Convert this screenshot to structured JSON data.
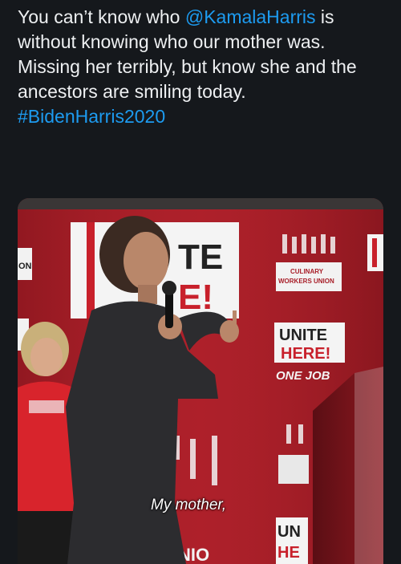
{
  "tweet": {
    "text_part1": "You can’t know who ",
    "mention": "@KamalaHarris",
    "text_part2": " is without knowing who our mother was. Missing her terribly, but know she and the ancestors are smiling today. ",
    "hashtag": "#BidenHarris2020"
  },
  "media": {
    "caption": "My mother,",
    "signs": {
      "big_sign_line1": "TE",
      "big_sign_line2": "E!",
      "right_sign_line1": "UNITE",
      "right_sign_line2": "HERE!",
      "one_job": "ONE JOB",
      "culinary_line1": "CULINARY",
      "culinary_line2": "WORKERS UNION",
      "left_edge": "ON",
      "bottom_right": "UN",
      "bottom_right2": "HE",
      "bottom_center": "NIO"
    }
  },
  "colors": {
    "background": "#15181c",
    "link": "#1d9bf0",
    "union_red": "#b3202c"
  }
}
